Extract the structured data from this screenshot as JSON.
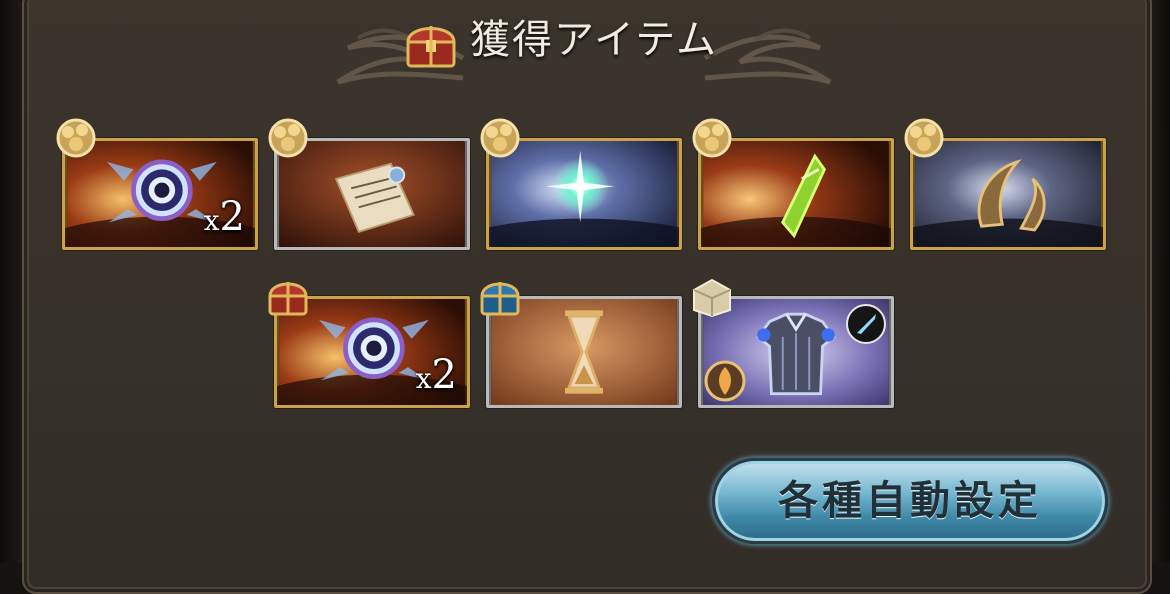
{
  "header": {
    "title": "獲得アイテム"
  },
  "rewards": [
    {
      "count_x": "x",
      "count_n": "2"
    },
    {
      "count_x": "x",
      "count_n": "2"
    }
  ],
  "buttons": {
    "auto_settings_label": "各種自動設定"
  },
  "colors": {
    "panel": "#3b352c",
    "gold_frame": "#c9a24a",
    "button_blue": "#5aa4c2",
    "title_text": "#f1ebe0"
  }
}
